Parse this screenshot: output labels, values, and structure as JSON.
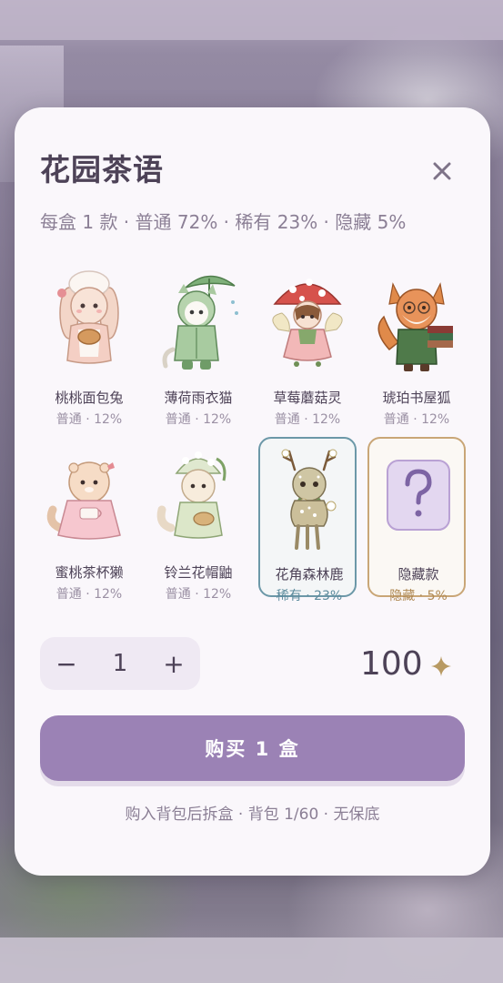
{
  "dialog": {
    "title": "花园茶语",
    "subtitle": "每盒 1 款 · 普通 72% · 稀有 23% · 隐藏 5%"
  },
  "items": [
    {
      "name": "桃桃面包兔",
      "rate": "普通 · 12%",
      "rarity": "common",
      "icon": "bunny-baker-icon"
    },
    {
      "name": "薄荷雨衣猫",
      "rate": "普通 · 12%",
      "rarity": "common",
      "icon": "raincoat-cat-icon"
    },
    {
      "name": "草莓蘑菇灵",
      "rate": "普通 · 12%",
      "rarity": "common",
      "icon": "mushroom-fairy-icon"
    },
    {
      "name": "琥珀书屋狐",
      "rate": "普通 · 12%",
      "rarity": "common",
      "icon": "bookshop-fox-icon"
    },
    {
      "name": "蜜桃茶杯獭",
      "rate": "普通 · 12%",
      "rarity": "common",
      "icon": "teacup-otter-icon"
    },
    {
      "name": "铃兰花帽鼬",
      "rate": "普通 · 12%",
      "rarity": "common",
      "icon": "lily-hat-weasel-icon"
    },
    {
      "name": "花角森林鹿",
      "rate": "稀有 · 23%",
      "rarity": "rare",
      "icon": "flower-antler-deer-icon"
    },
    {
      "name": "隐藏款",
      "rate": "隐藏 · 5%",
      "rarity": "hidden",
      "icon": "question-mark-icon"
    }
  ],
  "quantity": {
    "minus": "−",
    "value": "1",
    "plus": "+"
  },
  "price": {
    "amount": "100",
    "icon": "sparkle-star-icon"
  },
  "buy_button": "购买 1 盒",
  "footer_note": "购入背包后拆盒 · 背包 1/60 · 无保底",
  "colors": {
    "accent": "#9b82b5",
    "title": "#4d4257",
    "rare_border": "#6c98a8",
    "hidden_border": "#c9a677",
    "star": "#b89a63"
  }
}
